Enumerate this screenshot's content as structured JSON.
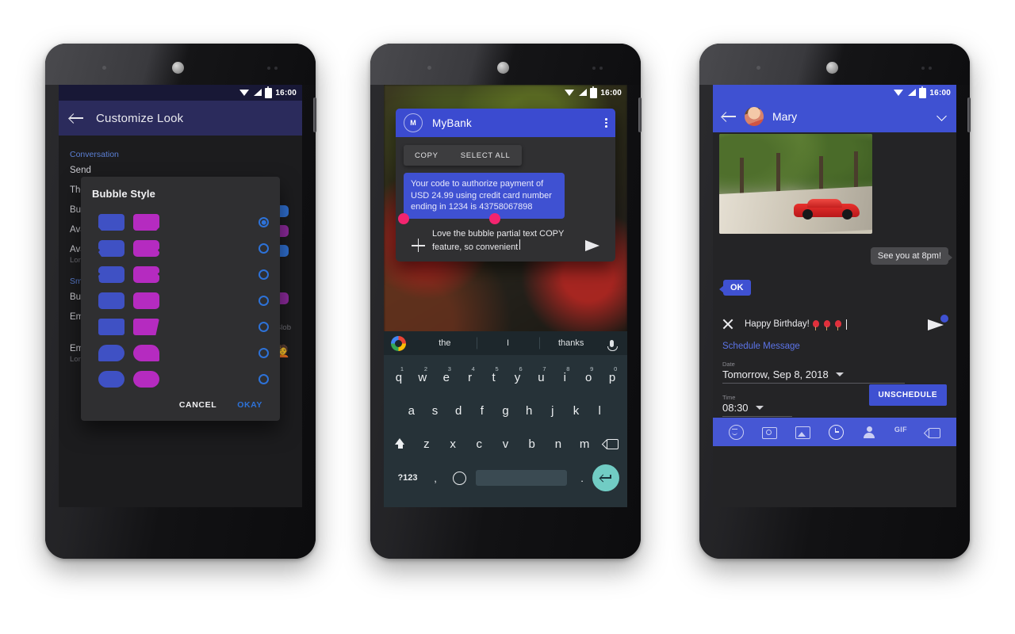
{
  "status_bar": {
    "time": "16:00",
    "icons": [
      "wifi-icon",
      "signal-icon",
      "battery-icon"
    ]
  },
  "phone1": {
    "appbar": {
      "back": "back-arrow-icon",
      "title": "Customize Look"
    },
    "background_settings": [
      {
        "section": "Conversation"
      },
      {
        "title": "Send",
        "subtitle": ""
      },
      {
        "title": "Theme",
        "subtitle": ""
      },
      {
        "title": "Bubble Style",
        "subtitle": ""
      },
      {
        "title": "Avatar",
        "subtitle": ""
      },
      {
        "title": "Avatar Style",
        "subtitle": "Long press to change\nContact avatar"
      },
      {
        "section": "Smileys"
      },
      {
        "title": "Bubble Color",
        "subtitle": ""
      },
      {
        "title": "Emoji Style",
        "subtitle": "Android Blob"
      },
      {
        "title": "Emoji Skin Tone",
        "subtitle": "Long press on emoji to change skin tone."
      }
    ],
    "dialog": {
      "title": "Bubble Style",
      "options": [
        {
          "id": 1,
          "selected": true,
          "shape": "notch-bottom-left"
        },
        {
          "id": 2,
          "selected": false,
          "shape": "notch-mid-left"
        },
        {
          "id": 3,
          "selected": false,
          "shape": "notch-center-left"
        },
        {
          "id": 4,
          "selected": false,
          "shape": "rounded-square"
        },
        {
          "id": 5,
          "selected": false,
          "shape": "flag-tail"
        },
        {
          "id": 6,
          "selected": false,
          "shape": "speech-round"
        },
        {
          "id": 7,
          "selected": false,
          "shape": "pill-round"
        }
      ],
      "cancel_label": "CANCEL",
      "okay_label": "OKAY",
      "colors": {
        "incoming": "#3f51c4",
        "outgoing": "#b52bc0",
        "radio": "#2d72d8"
      }
    }
  },
  "phone2": {
    "bubble_window": {
      "avatar_initial": "M",
      "contact": "MyBank",
      "menu_icon": "overflow-menu-icon",
      "context_menu": [
        "COPY",
        "SELECT ALL"
      ],
      "message": "Your code to authorize payment of USD 24.99 using credit card number ending in 1234 is 43758067898",
      "reply_draft": "Love the bubble partial text COPY feature, so convenient",
      "add_icon": "plus-icon",
      "send_icon": "send-icon",
      "header_color": "#3b4bd0",
      "selection_handle_color": "#f3246f"
    },
    "keyboard": {
      "suggestions": [
        "the",
        "I",
        "thanks"
      ],
      "logo": "google-logo-icon",
      "mic": "microphone-icon",
      "row1": [
        {
          "k": "q",
          "n": "1"
        },
        {
          "k": "w",
          "n": "2"
        },
        {
          "k": "e",
          "n": "3"
        },
        {
          "k": "r",
          "n": "4"
        },
        {
          "k": "t",
          "n": "5"
        },
        {
          "k": "y",
          "n": "6"
        },
        {
          "k": "u",
          "n": "7"
        },
        {
          "k": "i",
          "n": "8"
        },
        {
          "k": "o",
          "n": "9"
        },
        {
          "k": "p",
          "n": "0"
        }
      ],
      "row2": [
        "a",
        "s",
        "d",
        "f",
        "g",
        "h",
        "j",
        "k",
        "l"
      ],
      "row3": [
        "z",
        "x",
        "c",
        "v",
        "b",
        "n",
        "m"
      ],
      "shift": "shift-icon",
      "backspace": "backspace-icon",
      "numeric_key": "?123",
      "comma_key": ",",
      "emoji_key": "emoji-icon",
      "period_key": ".",
      "enter_key": "enter-icon",
      "enter_color": "#71ccc4"
    }
  },
  "phone3": {
    "appbar": {
      "back": "back-arrow-icon",
      "avatar": "contact-avatar",
      "name": "Mary",
      "chevron": "chevron-down-icon"
    },
    "thread": [
      {
        "type": "image",
        "name": "red-sports-car-photo",
        "side": "incoming"
      },
      {
        "type": "text",
        "text": "See you at 8pm!",
        "side": "incoming"
      },
      {
        "type": "text",
        "text": "OK",
        "side": "outgoing"
      }
    ],
    "compose": {
      "close_icon": "close-icon",
      "text": "Happy Birthday!",
      "emojis": [
        "balloon",
        "balloon",
        "balloon"
      ],
      "send_icon": "send-scheduled-icon"
    },
    "schedule": {
      "link": "Schedule Message",
      "date_label": "Date",
      "date_value": "Tomorrow, Sep 8, 2018",
      "time_label": "Time",
      "time_value": "08:30",
      "button": "UNSCHEDULE"
    },
    "toolbar": [
      {
        "icon": "emoji-icon",
        "active": false
      },
      {
        "icon": "camera-icon",
        "active": false
      },
      {
        "icon": "gallery-icon",
        "active": false
      },
      {
        "icon": "schedule-clock-icon",
        "active": true
      },
      {
        "icon": "contact-icon",
        "active": false
      },
      {
        "icon": "gif-icon",
        "label": "GIF",
        "active": false
      },
      {
        "icon": "backspace-icon",
        "active": false
      }
    ],
    "colors": {
      "accent": "#3f51d2",
      "toolbar": "#4657d4"
    }
  }
}
